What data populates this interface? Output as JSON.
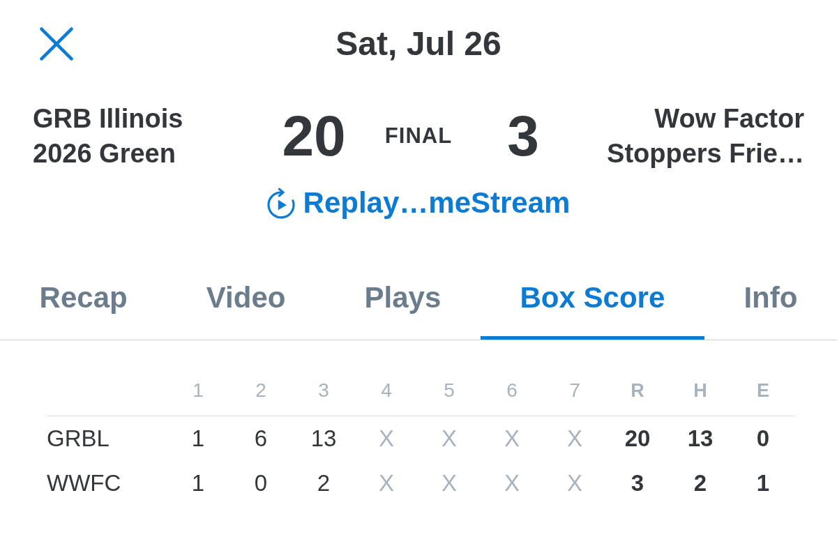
{
  "header": {
    "title": "Sat, Jul 26"
  },
  "matchup": {
    "teams": [
      {
        "name": "GRB Illinois\n2026 Green",
        "score": "20"
      },
      {
        "name": "Wow Factor\nStoppers Frie…",
        "score": "3"
      }
    ],
    "status": "FINAL"
  },
  "replay_link": {
    "label": "Replay…meStream"
  },
  "tabs": [
    {
      "label": "Recap",
      "selected": false
    },
    {
      "label": "Video",
      "selected": false
    },
    {
      "label": "Plays",
      "selected": false
    },
    {
      "label": "Box Score",
      "selected": true
    },
    {
      "label": "Info",
      "selected": false
    }
  ],
  "box_score": {
    "inning_columns": [
      "1",
      "2",
      "3",
      "4",
      "5",
      "6",
      "7"
    ],
    "total_columns": [
      "R",
      "H",
      "E"
    ],
    "rows": [
      {
        "team": "GRBL",
        "innings": [
          {
            "value": "1",
            "played": true
          },
          {
            "value": "6",
            "played": true
          },
          {
            "value": "13",
            "played": true
          },
          {
            "value": "X",
            "played": false
          },
          {
            "value": "X",
            "played": false
          },
          {
            "value": "X",
            "played": false
          },
          {
            "value": "X",
            "played": false
          }
        ],
        "totals": [
          "20",
          "13",
          "0"
        ]
      },
      {
        "team": "WWFC",
        "innings": [
          {
            "value": "1",
            "played": true
          },
          {
            "value": "0",
            "played": true
          },
          {
            "value": "2",
            "played": true
          },
          {
            "value": "X",
            "played": false
          },
          {
            "value": "X",
            "played": false
          },
          {
            "value": "X",
            "played": false
          },
          {
            "value": "X",
            "played": false
          }
        ],
        "totals": [
          "3",
          "2",
          "1"
        ]
      }
    ]
  }
}
